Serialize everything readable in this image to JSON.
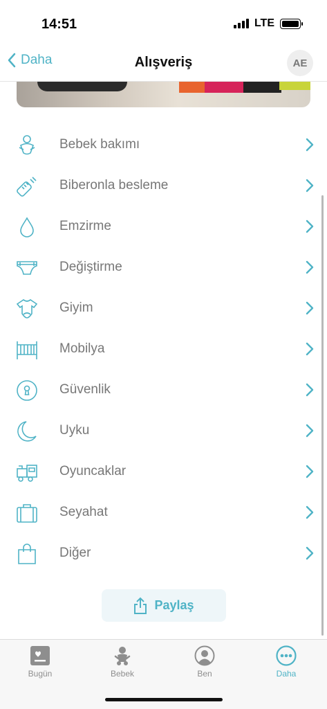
{
  "status_bar": {
    "time": "14:51",
    "network": "LTE"
  },
  "nav": {
    "back_label": "Daha",
    "title": "Alışveriş",
    "avatar_initials": "AE"
  },
  "categories": [
    {
      "label": "Bebek bakımı",
      "icon": "baby-care-icon"
    },
    {
      "label": "Biberonla besleme",
      "icon": "baby-bottle-icon"
    },
    {
      "label": "Emzirme",
      "icon": "drop-icon"
    },
    {
      "label": "Değiştirme",
      "icon": "diaper-icon"
    },
    {
      "label": "Giyim",
      "icon": "onesie-icon"
    },
    {
      "label": "Mobilya",
      "icon": "crib-icon"
    },
    {
      "label": "Güvenlik",
      "icon": "keyhole-icon"
    },
    {
      "label": "Uyku",
      "icon": "moon-icon"
    },
    {
      "label": "Oyuncaklar",
      "icon": "toy-train-icon"
    },
    {
      "label": "Seyahat",
      "icon": "suitcase-icon"
    },
    {
      "label": "Diğer",
      "icon": "shopping-bag-icon"
    }
  ],
  "share_label": "Paylaş",
  "tabs": [
    {
      "label": "Bugün",
      "icon": "today-icon",
      "active": false
    },
    {
      "label": "Bebek",
      "icon": "baby-icon",
      "active": false
    },
    {
      "label": "Ben",
      "icon": "profile-icon",
      "active": false
    },
    {
      "label": "Daha",
      "icon": "more-icon",
      "active": true
    }
  ],
  "colors": {
    "accent": "#4fb3c6",
    "label_gray": "#777777",
    "tab_gray": "#8e8e8e"
  }
}
